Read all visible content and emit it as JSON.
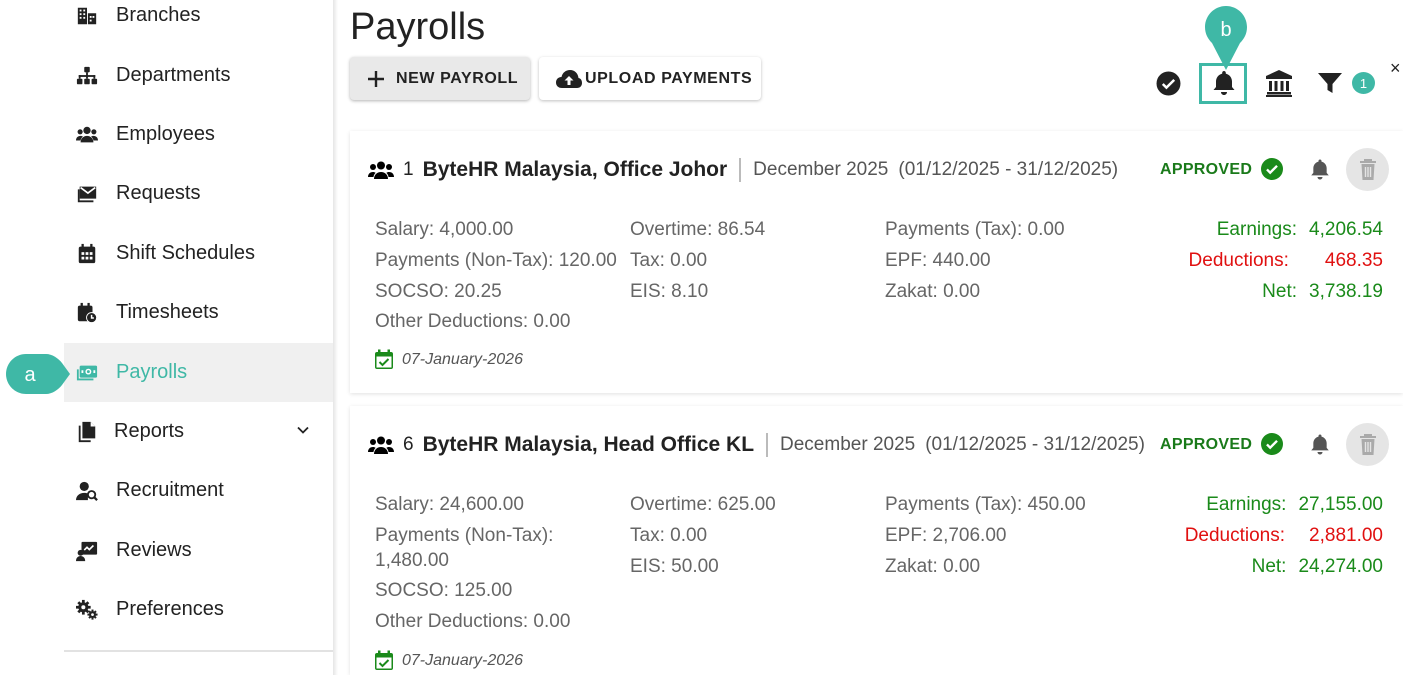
{
  "sidebar": {
    "items": [
      {
        "label": "Branches",
        "icon": "branches-icon"
      },
      {
        "label": "Departments",
        "icon": "departments-icon"
      },
      {
        "label": "Employees",
        "icon": "employees-icon"
      },
      {
        "label": "Requests",
        "icon": "requests-icon"
      },
      {
        "label": "Shift Schedules",
        "icon": "calendar-icon"
      },
      {
        "label": "Timesheets",
        "icon": "timesheet-icon"
      },
      {
        "label": "Payrolls",
        "icon": "payroll-icon",
        "active": true
      },
      {
        "label": "Reports",
        "icon": "reports-icon",
        "expandable": true
      },
      {
        "label": "Recruitment",
        "icon": "recruitment-icon"
      },
      {
        "label": "Reviews",
        "icon": "reviews-icon"
      },
      {
        "label": "Preferences",
        "icon": "gears-icon"
      }
    ]
  },
  "markers": {
    "a": "a",
    "b": "b"
  },
  "header": {
    "title": "Payrolls",
    "new_payroll": "NEW PAYROLL",
    "upload_payments": "UPLOAD PAYMENTS",
    "filter_count": "1",
    "close": "×"
  },
  "colors": {
    "accent": "#3fb8a6",
    "approved": "#1a7a1a",
    "earnings": "#1a8a1a",
    "deductions": "#e01010"
  },
  "payrolls": [
    {
      "num": "1",
      "company": "ByteHR Malaysia,  Office Johor",
      "period": "December 2025",
      "range": "(01/12/2025 - 31/12/2025)",
      "status": "APPROVED",
      "col1": [
        "Salary: 4,000.00",
        "Payments (Non-Tax): 120.00",
        "SOCSO: 20.25",
        "Other Deductions: 0.00"
      ],
      "col2": [
        "Overtime: 86.54",
        "Tax: 0.00",
        "EIS: 8.10"
      ],
      "col3": [
        "Payments (Tax): 0.00",
        "EPF: 440.00",
        "Zakat: 0.00"
      ],
      "earnings_label": "Earnings:",
      "earnings": "4,206.54",
      "deductions_label": "Deductions:",
      "deductions": "468.35",
      "net_label": "Net:",
      "net": "3,738.19",
      "date": "07-January-2026"
    },
    {
      "num": "6",
      "company": "ByteHR Malaysia,  Head Office KL",
      "period": "December 2025",
      "range": "(01/12/2025 - 31/12/2025)",
      "status": "APPROVED",
      "col1": [
        "Salary: 24,600.00",
        "Payments (Non-Tax):",
        "1,480.00",
        "SOCSO: 125.00",
        "Other Deductions: 0.00"
      ],
      "col2": [
        "Overtime: 625.00",
        "Tax: 0.00",
        "EIS: 50.00"
      ],
      "col3": [
        "Payments (Tax): 450.00",
        "EPF: 2,706.00",
        "Zakat: 0.00"
      ],
      "earnings_label": "Earnings:",
      "earnings": "27,155.00",
      "deductions_label": "Deductions:",
      "deductions": "2,881.00",
      "net_label": "Net:",
      "net": "24,274.00",
      "date": "07-January-2026"
    }
  ]
}
